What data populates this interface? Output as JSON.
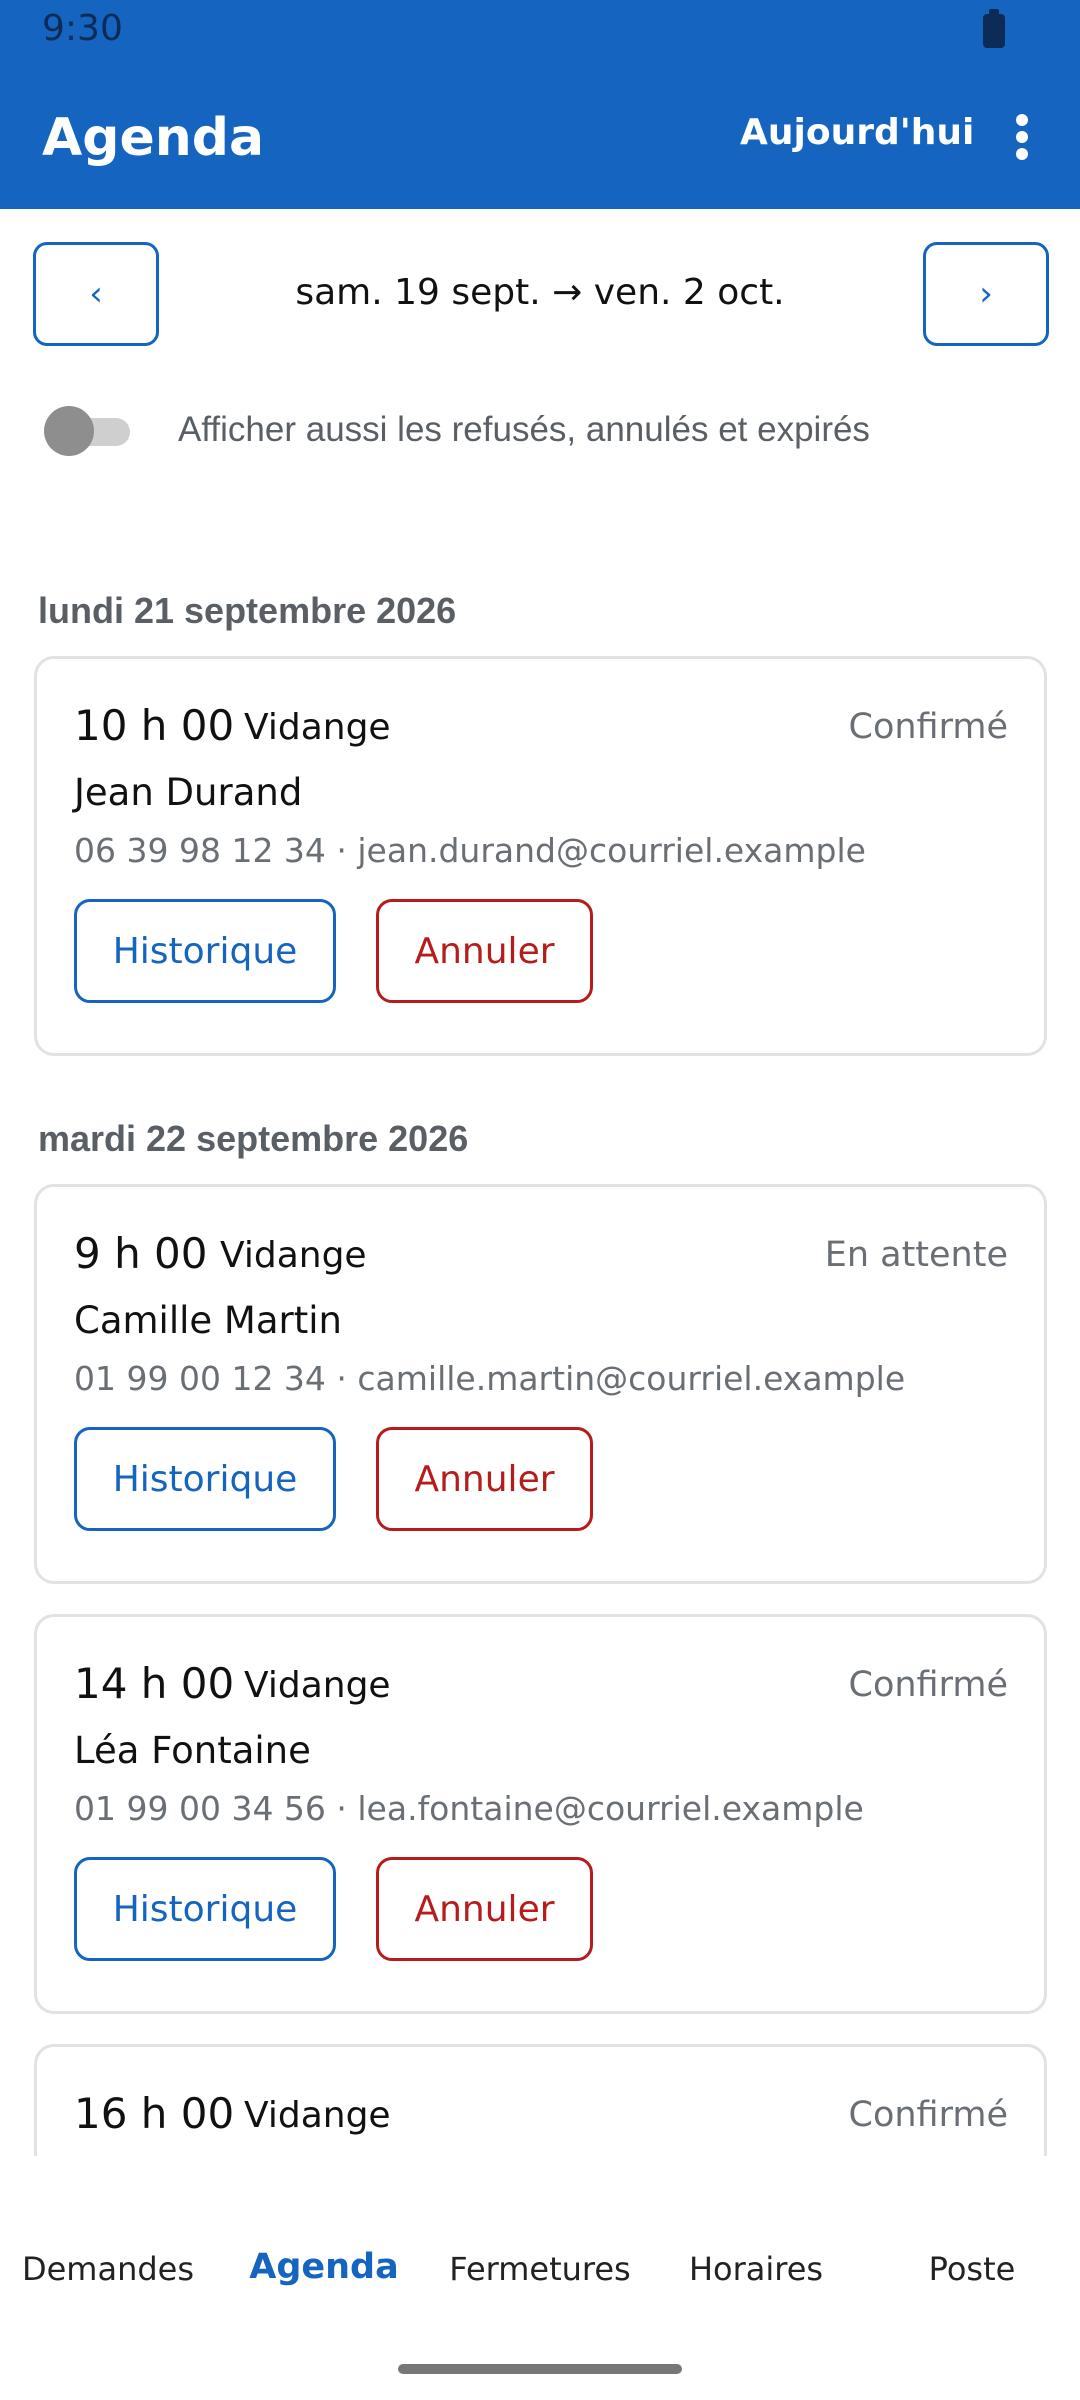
{
  "status_bar": {
    "time": "9:30"
  },
  "app_bar": {
    "title": "Agenda",
    "today_label": "Aujourd'hui"
  },
  "date_nav": {
    "prev_label": "‹",
    "next_label": "›",
    "range": "sam. 19 sept. → ven. 2 oct."
  },
  "filter": {
    "label": "Afficher aussi les refusés, annulés et expirés",
    "enabled": false
  },
  "days": [
    {
      "header": "lundi 21 septembre 2026",
      "appointments": [
        {
          "time": "10 h 00",
          "service": "Vidange",
          "status": "Confirmé",
          "name": "Jean Durand",
          "contact": "06 39 98 12 34 · jean.durand@courriel.example",
          "history_label": "Historique",
          "cancel_label": "Annuler"
        }
      ]
    },
    {
      "header": "mardi 22 septembre 2026",
      "appointments": [
        {
          "time": "9 h 00",
          "service": "Vidange",
          "status": "En attente",
          "name": "Camille Martin",
          "contact": "01 99 00 12 34 · camille.martin@courriel.example",
          "history_label": "Historique",
          "cancel_label": "Annuler"
        },
        {
          "time": "14 h 00",
          "service": "Vidange",
          "status": "Confirmé",
          "name": "Léa Fontaine",
          "contact": "01 99 00 34 56 · lea.fontaine@courriel.example",
          "history_label": "Historique",
          "cancel_label": "Annuler"
        },
        {
          "time": "16 h 00",
          "service": "Vidange",
          "status": "Confirmé"
        }
      ]
    }
  ],
  "bottom_nav": {
    "tabs": [
      "Demandes",
      "Agenda",
      "Fermetures",
      "Horaires",
      "Poste"
    ],
    "active": "Agenda"
  },
  "colors": {
    "primary": "#1565c0",
    "danger": "#b71c1c",
    "muted": "#6a6f75"
  }
}
